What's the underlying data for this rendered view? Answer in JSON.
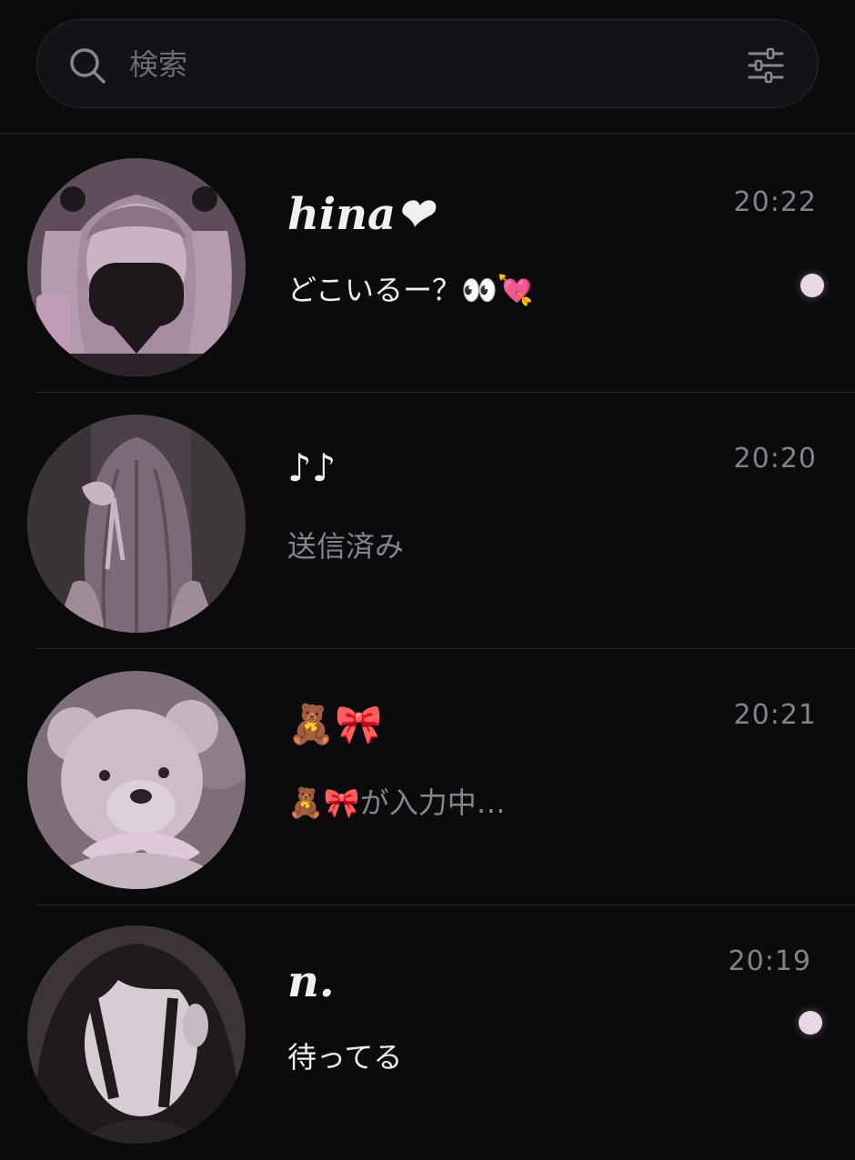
{
  "search": {
    "placeholder": "検索",
    "icon": "search-icon",
    "filter_icon": "sliders-icon"
  },
  "colors": {
    "background": "#0b0a0d",
    "search_bg": "#141216",
    "unread_dot": "#e8d8e6",
    "avatar_tint": "#a68ea2"
  },
  "chats": [
    {
      "name": "hina❤",
      "message": "どこいるー？👀💘",
      "time": "20:22",
      "unread": true,
      "avatar": "girl-twin-tails-mask-avatar"
    },
    {
      "name": "♪♪",
      "message": "送信済み",
      "time": "20:20",
      "unread": false,
      "avatar": "girl-back-ribbon-avatar"
    },
    {
      "name": "🧸🎀",
      "message": "🧸🎀が入力中…",
      "time": "20:21",
      "unread": false,
      "avatar": "teddy-bear-avatar"
    },
    {
      "name": "n.",
      "message": "待ってる",
      "time": "20:19",
      "unread": true,
      "avatar": "dark-hair-girl-avatar"
    }
  ]
}
